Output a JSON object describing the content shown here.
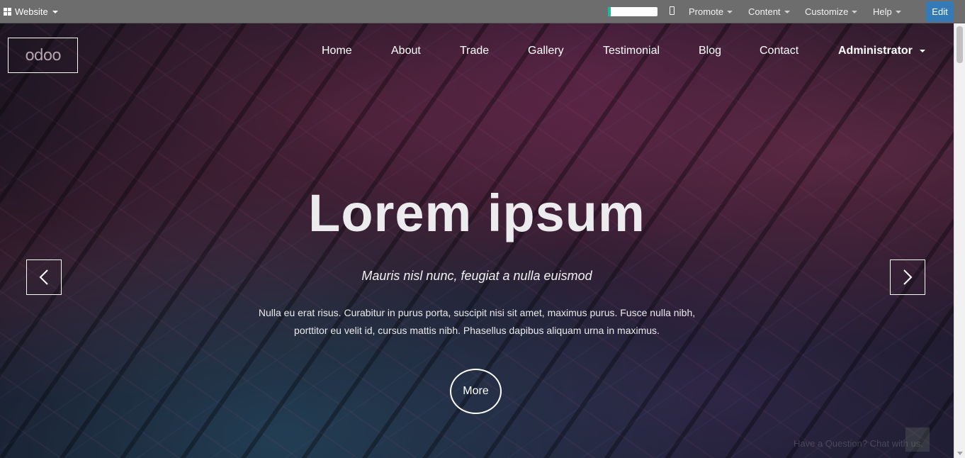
{
  "adminbar": {
    "website_label": "Website",
    "progress": 0.05,
    "menus": [
      "Promote",
      "Content",
      "Customize",
      "Help"
    ],
    "edit_label": "Edit",
    "accent_color": "#337ab7"
  },
  "site": {
    "logo_text": "odoo",
    "nav": [
      "Home",
      "About",
      "Trade",
      "Gallery",
      "Testimonial",
      "Blog",
      "Contact"
    ],
    "user_label": "Administrator"
  },
  "hero": {
    "title": "Lorem ipsum",
    "subtitle": "Mauris nisl nunc, feugiat a nulla euismod",
    "body_line1": "Nulla eu erat risus. Curabitur in purus porta, suscipit nisi sit amet, maximus purus. Fusce nulla nibh,",
    "body_line2": "porttitor eu velit id, cursus mattis nibh. Phasellus dapibus aliquam urna in maximus.",
    "button_label": "More",
    "chat_hint": "Have a Question? Chat with us."
  },
  "icons": {
    "apps": "grid-icon",
    "mobile": "mobile-icon",
    "prev": "chevron-left-icon",
    "next": "chevron-right-icon"
  }
}
